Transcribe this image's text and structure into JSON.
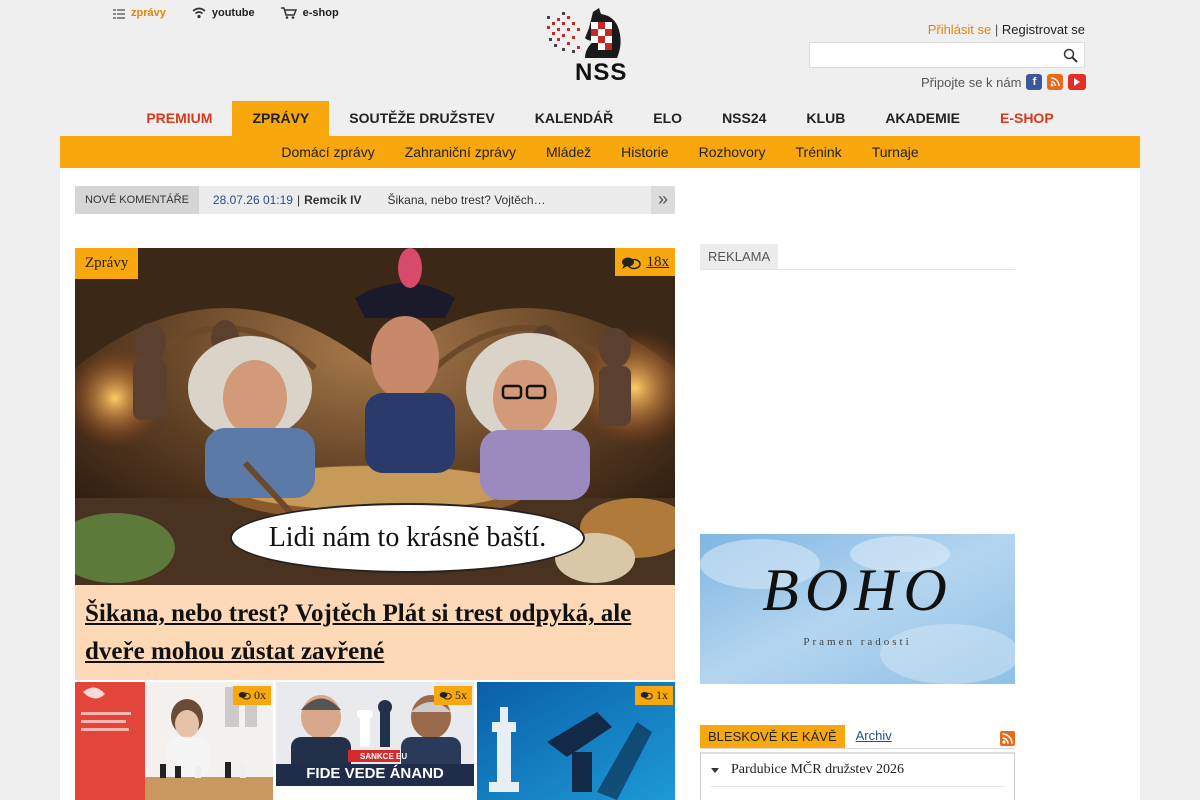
{
  "top_links": [
    {
      "label": "zprávy",
      "icon": "news-list-icon"
    },
    {
      "label": "youtube",
      "icon": "wifi-icon"
    },
    {
      "label": "e-shop",
      "icon": "cart-icon"
    }
  ],
  "logo": {
    "text": "NSS"
  },
  "auth": {
    "login": "Přihlásit se",
    "separator": "|",
    "register": "Registrovat se"
  },
  "search": {
    "value": "",
    "placeholder": ""
  },
  "connect": {
    "label": "Připojte se k nám",
    "icons": [
      "facebook-icon",
      "rss-icon",
      "youtube-icon"
    ]
  },
  "main_nav": [
    {
      "label": "PREMIUM",
      "style": "red"
    },
    {
      "label": "ZPRÁVY",
      "style": "active"
    },
    {
      "label": "SOUTĚŽE DRUŽSTEV",
      "style": ""
    },
    {
      "label": "KALENDÁŘ",
      "style": ""
    },
    {
      "label": "ELO",
      "style": ""
    },
    {
      "label": "NSS24",
      "style": ""
    },
    {
      "label": "KLUB",
      "style": ""
    },
    {
      "label": "AKADEMIE",
      "style": ""
    },
    {
      "label": "E-SHOP",
      "style": "red"
    }
  ],
  "sub_nav": [
    "Domácí zprávy",
    "Zahraniční zprávy",
    "Mládež",
    "Historie",
    "Rozhovory",
    "Trénink",
    "Turnaje"
  ],
  "ticker": {
    "label": "NOVÉ KOMENTÁŘE",
    "date": "28.07.26 01:19",
    "separator": "|",
    "author": "Remcik IV",
    "text": "Šikana, nebo trest? Vojtěch…",
    "next": "»"
  },
  "hero": {
    "category": "Zprávy",
    "comments": "18x",
    "speech": "Lidi nám to krásně baští.",
    "headline": "Šikana, nebo trest? Vojtěch Plát si trest odpyká, ale dveře mohou zůstat zavřené"
  },
  "thumbs": [
    {
      "comments": "0x"
    },
    {
      "comments": "5x",
      "banner_top": "SANKCE EU",
      "banner_main": "FIDE VEDE ÁNAND"
    },
    {
      "comments": "1x"
    }
  ],
  "ad": {
    "label": "REKLAMA",
    "banner_title": "BOHO",
    "banner_sub": "Pramen radosti"
  },
  "quick": {
    "tab": "BLESKOVĚ KE KÁVĚ",
    "archive": "Archiv",
    "items": [
      "Pardubice MČR družstev 2026"
    ]
  },
  "colors": {
    "accent": "#f8a80d",
    "red": "#d63a1b",
    "link": "#2a4d8a",
    "headline_bg": "#fdd9b8"
  }
}
